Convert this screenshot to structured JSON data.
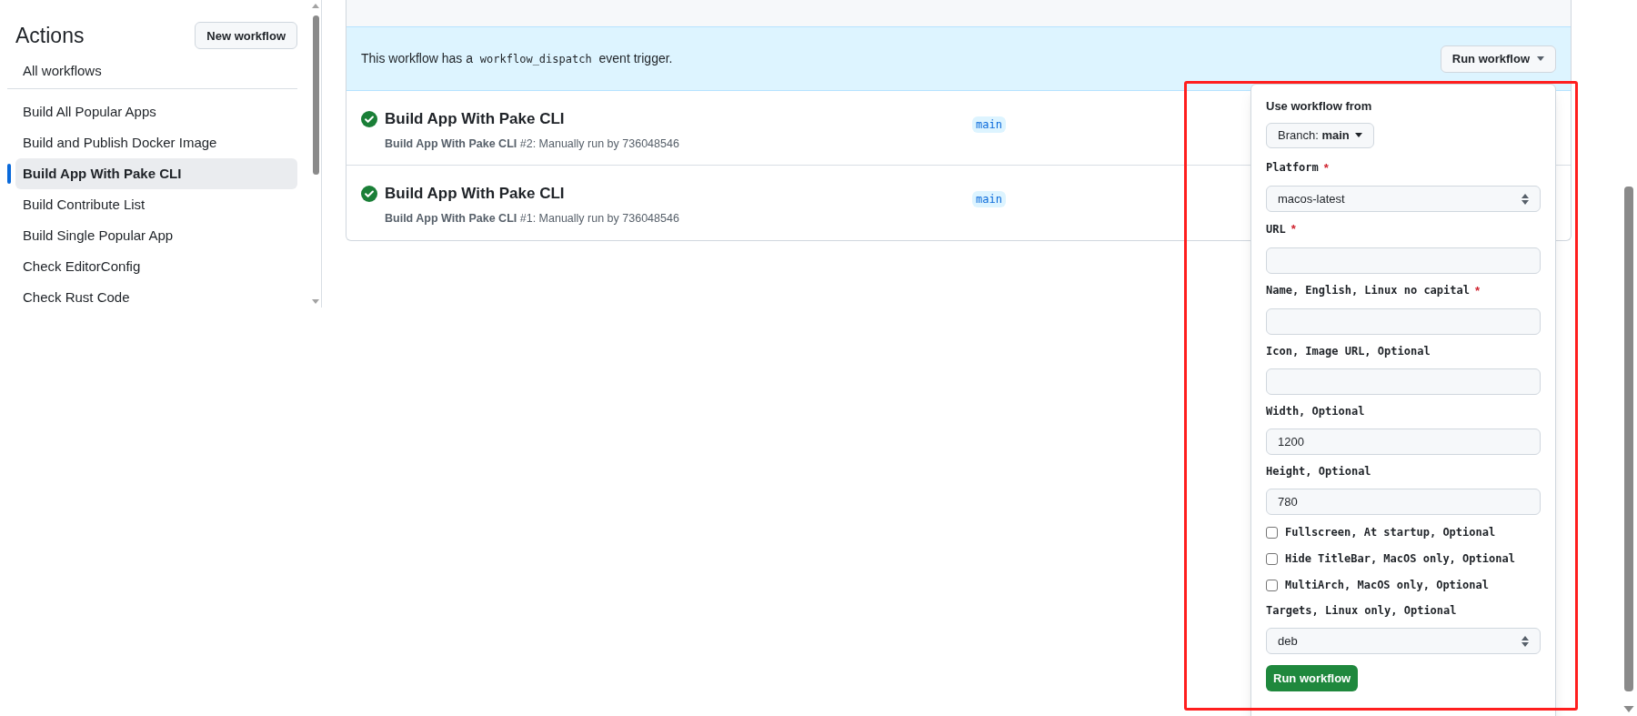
{
  "sidebar": {
    "title": "Actions",
    "new_button": "New workflow",
    "all_link": "All workflows",
    "items": [
      {
        "label": "Build All Popular Apps",
        "selected": false
      },
      {
        "label": "Build and Publish Docker Image",
        "selected": false
      },
      {
        "label": "Build App With Pake CLI",
        "selected": true
      },
      {
        "label": "Build Contribute List",
        "selected": false
      },
      {
        "label": "Build Single Popular App",
        "selected": false
      },
      {
        "label": "Check EditorConfig",
        "selected": false
      },
      {
        "label": "Check Rust Code",
        "selected": false
      }
    ]
  },
  "banner": {
    "text_before": "This workflow has a",
    "code": "workflow_dispatch",
    "text_after": "event trigger.",
    "button": "Run workflow"
  },
  "runs": [
    {
      "kind": "success",
      "title": "Build App With Pake CLI",
      "detail": "**Build App With Pake CLI** #2: Manually run by 736048546",
      "branch": "main"
    },
    {
      "kind": "success",
      "title": "Build App With Pake CLI",
      "detail": "**Build App With Pake CLI** #1: Manually run by 736048546",
      "branch": "main"
    }
  ],
  "dispatch_form": {
    "heading": "Use workflow from",
    "branch_button": "Branch: **main**",
    "fields": [
      {
        "kind": "select",
        "label": "Platform",
        "marker": "*",
        "value": "macos-latest"
      },
      {
        "kind": "text",
        "label": "URL",
        "marker": "*"
      },
      {
        "kind": "text",
        "label": "Name, English, Linux no capital",
        "marker": "*"
      },
      {
        "kind": "text",
        "label": "Icon, Image URL, Optional"
      },
      {
        "kind": "text",
        "label": "Width, Optional",
        "value": "1200"
      },
      {
        "kind": "text",
        "label": "Height, Optional",
        "value": "780"
      },
      {
        "kind": "checkbox",
        "label": "Fullscreen, At startup, Optional",
        "checked": false
      },
      {
        "kind": "checkbox",
        "label": "Hide TitleBar, MacOS only, Optional",
        "checked": false
      },
      {
        "kind": "checkbox",
        "label": "MultiArch, MacOS only, Optional",
        "checked": false
      },
      {
        "kind": "select",
        "label": "Targets, Linux only, Optional",
        "value": "deb"
      }
    ],
    "submit": "Run workflow"
  }
}
